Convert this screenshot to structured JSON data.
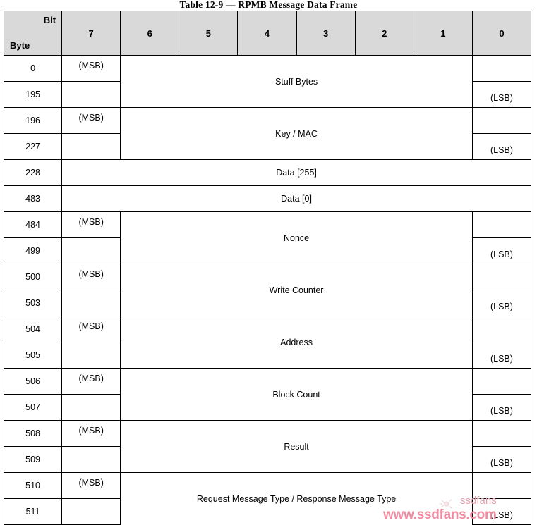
{
  "document": {
    "caption": "Table 12-9 — RPMB Message Data Frame"
  },
  "table": {
    "corner": {
      "bit_label": "Bit",
      "byte_label": "Byte"
    },
    "bit_columns": [
      "7",
      "6",
      "5",
      "4",
      "3",
      "2",
      "1",
      "0"
    ],
    "msb_text": "(MSB)",
    "lsb_text": "(LSB)",
    "rows": [
      {
        "type": "pair",
        "start_byte": "0",
        "end_byte": "195",
        "field": "Stuff Bytes",
        "msb": "(MSB)",
        "lsb": "(LSB)"
      },
      {
        "type": "pair",
        "start_byte": "196",
        "end_byte": "227",
        "field": "Key / MAC",
        "msb": "(MSB)",
        "lsb": "(LSB)"
      },
      {
        "type": "single",
        "byte": "228",
        "field": "Data [255]"
      },
      {
        "type": "single",
        "byte": "483",
        "field": "Data [0]"
      },
      {
        "type": "pair",
        "start_byte": "484",
        "end_byte": "499",
        "field": "Nonce",
        "msb": "(MSB)",
        "lsb": "(LSB)"
      },
      {
        "type": "pair",
        "start_byte": "500",
        "end_byte": "503",
        "field": "Write Counter",
        "msb": "(MSB)",
        "lsb": "(LSB)"
      },
      {
        "type": "pair",
        "start_byte": "504",
        "end_byte": "505",
        "field": "Address",
        "msb": "(MSB)",
        "lsb": "(LSB)"
      },
      {
        "type": "pair",
        "start_byte": "506",
        "end_byte": "507",
        "field": "Block Count",
        "msb": "(MSB)",
        "lsb": "(LSB)"
      },
      {
        "type": "pair",
        "start_byte": "508",
        "end_byte": "509",
        "field": "Result",
        "msb": "(MSB)",
        "lsb": "(LSB)"
      },
      {
        "type": "pair",
        "start_byte": "510",
        "end_byte": "511",
        "field": "Request Message Type / Response Message Type",
        "msb": "(MSB)",
        "lsb": "(LSB)"
      }
    ]
  },
  "watermark": {
    "url": "www.ssdfans.com",
    "brand": "ssdfans"
  },
  "colors": {
    "header_background": "#d9d9d9",
    "border": "#000000",
    "watermark_pink": "#f08ca0",
    "page_background": "#ffffff"
  }
}
